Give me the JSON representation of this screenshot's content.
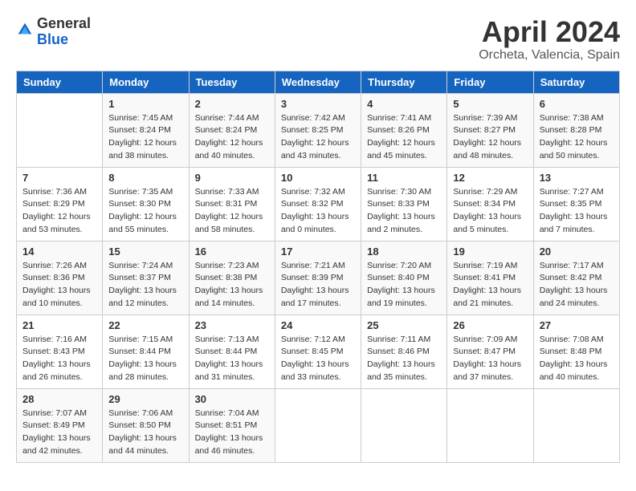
{
  "logo": {
    "text_general": "General",
    "text_blue": "Blue"
  },
  "header": {
    "month": "April 2024",
    "location": "Orcheta, Valencia, Spain"
  },
  "weekdays": [
    "Sunday",
    "Monday",
    "Tuesday",
    "Wednesday",
    "Thursday",
    "Friday",
    "Saturday"
  ],
  "weeks": [
    [
      {
        "day": "",
        "sunrise": "",
        "sunset": "",
        "daylight": ""
      },
      {
        "day": "1",
        "sunrise": "Sunrise: 7:45 AM",
        "sunset": "Sunset: 8:24 PM",
        "daylight": "Daylight: 12 hours and 38 minutes."
      },
      {
        "day": "2",
        "sunrise": "Sunrise: 7:44 AM",
        "sunset": "Sunset: 8:24 PM",
        "daylight": "Daylight: 12 hours and 40 minutes."
      },
      {
        "day": "3",
        "sunrise": "Sunrise: 7:42 AM",
        "sunset": "Sunset: 8:25 PM",
        "daylight": "Daylight: 12 hours and 43 minutes."
      },
      {
        "day": "4",
        "sunrise": "Sunrise: 7:41 AM",
        "sunset": "Sunset: 8:26 PM",
        "daylight": "Daylight: 12 hours and 45 minutes."
      },
      {
        "day": "5",
        "sunrise": "Sunrise: 7:39 AM",
        "sunset": "Sunset: 8:27 PM",
        "daylight": "Daylight: 12 hours and 48 minutes."
      },
      {
        "day": "6",
        "sunrise": "Sunrise: 7:38 AM",
        "sunset": "Sunset: 8:28 PM",
        "daylight": "Daylight: 12 hours and 50 minutes."
      }
    ],
    [
      {
        "day": "7",
        "sunrise": "Sunrise: 7:36 AM",
        "sunset": "Sunset: 8:29 PM",
        "daylight": "Daylight: 12 hours and 53 minutes."
      },
      {
        "day": "8",
        "sunrise": "Sunrise: 7:35 AM",
        "sunset": "Sunset: 8:30 PM",
        "daylight": "Daylight: 12 hours and 55 minutes."
      },
      {
        "day": "9",
        "sunrise": "Sunrise: 7:33 AM",
        "sunset": "Sunset: 8:31 PM",
        "daylight": "Daylight: 12 hours and 58 minutes."
      },
      {
        "day": "10",
        "sunrise": "Sunrise: 7:32 AM",
        "sunset": "Sunset: 8:32 PM",
        "daylight": "Daylight: 13 hours and 0 minutes."
      },
      {
        "day": "11",
        "sunrise": "Sunrise: 7:30 AM",
        "sunset": "Sunset: 8:33 PM",
        "daylight": "Daylight: 13 hours and 2 minutes."
      },
      {
        "day": "12",
        "sunrise": "Sunrise: 7:29 AM",
        "sunset": "Sunset: 8:34 PM",
        "daylight": "Daylight: 13 hours and 5 minutes."
      },
      {
        "day": "13",
        "sunrise": "Sunrise: 7:27 AM",
        "sunset": "Sunset: 8:35 PM",
        "daylight": "Daylight: 13 hours and 7 minutes."
      }
    ],
    [
      {
        "day": "14",
        "sunrise": "Sunrise: 7:26 AM",
        "sunset": "Sunset: 8:36 PM",
        "daylight": "Daylight: 13 hours and 10 minutes."
      },
      {
        "day": "15",
        "sunrise": "Sunrise: 7:24 AM",
        "sunset": "Sunset: 8:37 PM",
        "daylight": "Daylight: 13 hours and 12 minutes."
      },
      {
        "day": "16",
        "sunrise": "Sunrise: 7:23 AM",
        "sunset": "Sunset: 8:38 PM",
        "daylight": "Daylight: 13 hours and 14 minutes."
      },
      {
        "day": "17",
        "sunrise": "Sunrise: 7:21 AM",
        "sunset": "Sunset: 8:39 PM",
        "daylight": "Daylight: 13 hours and 17 minutes."
      },
      {
        "day": "18",
        "sunrise": "Sunrise: 7:20 AM",
        "sunset": "Sunset: 8:40 PM",
        "daylight": "Daylight: 13 hours and 19 minutes."
      },
      {
        "day": "19",
        "sunrise": "Sunrise: 7:19 AM",
        "sunset": "Sunset: 8:41 PM",
        "daylight": "Daylight: 13 hours and 21 minutes."
      },
      {
        "day": "20",
        "sunrise": "Sunrise: 7:17 AM",
        "sunset": "Sunset: 8:42 PM",
        "daylight": "Daylight: 13 hours and 24 minutes."
      }
    ],
    [
      {
        "day": "21",
        "sunrise": "Sunrise: 7:16 AM",
        "sunset": "Sunset: 8:43 PM",
        "daylight": "Daylight: 13 hours and 26 minutes."
      },
      {
        "day": "22",
        "sunrise": "Sunrise: 7:15 AM",
        "sunset": "Sunset: 8:44 PM",
        "daylight": "Daylight: 13 hours and 28 minutes."
      },
      {
        "day": "23",
        "sunrise": "Sunrise: 7:13 AM",
        "sunset": "Sunset: 8:44 PM",
        "daylight": "Daylight: 13 hours and 31 minutes."
      },
      {
        "day": "24",
        "sunrise": "Sunrise: 7:12 AM",
        "sunset": "Sunset: 8:45 PM",
        "daylight": "Daylight: 13 hours and 33 minutes."
      },
      {
        "day": "25",
        "sunrise": "Sunrise: 7:11 AM",
        "sunset": "Sunset: 8:46 PM",
        "daylight": "Daylight: 13 hours and 35 minutes."
      },
      {
        "day": "26",
        "sunrise": "Sunrise: 7:09 AM",
        "sunset": "Sunset: 8:47 PM",
        "daylight": "Daylight: 13 hours and 37 minutes."
      },
      {
        "day": "27",
        "sunrise": "Sunrise: 7:08 AM",
        "sunset": "Sunset: 8:48 PM",
        "daylight": "Daylight: 13 hours and 40 minutes."
      }
    ],
    [
      {
        "day": "28",
        "sunrise": "Sunrise: 7:07 AM",
        "sunset": "Sunset: 8:49 PM",
        "daylight": "Daylight: 13 hours and 42 minutes."
      },
      {
        "day": "29",
        "sunrise": "Sunrise: 7:06 AM",
        "sunset": "Sunset: 8:50 PM",
        "daylight": "Daylight: 13 hours and 44 minutes."
      },
      {
        "day": "30",
        "sunrise": "Sunrise: 7:04 AM",
        "sunset": "Sunset: 8:51 PM",
        "daylight": "Daylight: 13 hours and 46 minutes."
      },
      {
        "day": "",
        "sunrise": "",
        "sunset": "",
        "daylight": ""
      },
      {
        "day": "",
        "sunrise": "",
        "sunset": "",
        "daylight": ""
      },
      {
        "day": "",
        "sunrise": "",
        "sunset": "",
        "daylight": ""
      },
      {
        "day": "",
        "sunrise": "",
        "sunset": "",
        "daylight": ""
      }
    ]
  ]
}
